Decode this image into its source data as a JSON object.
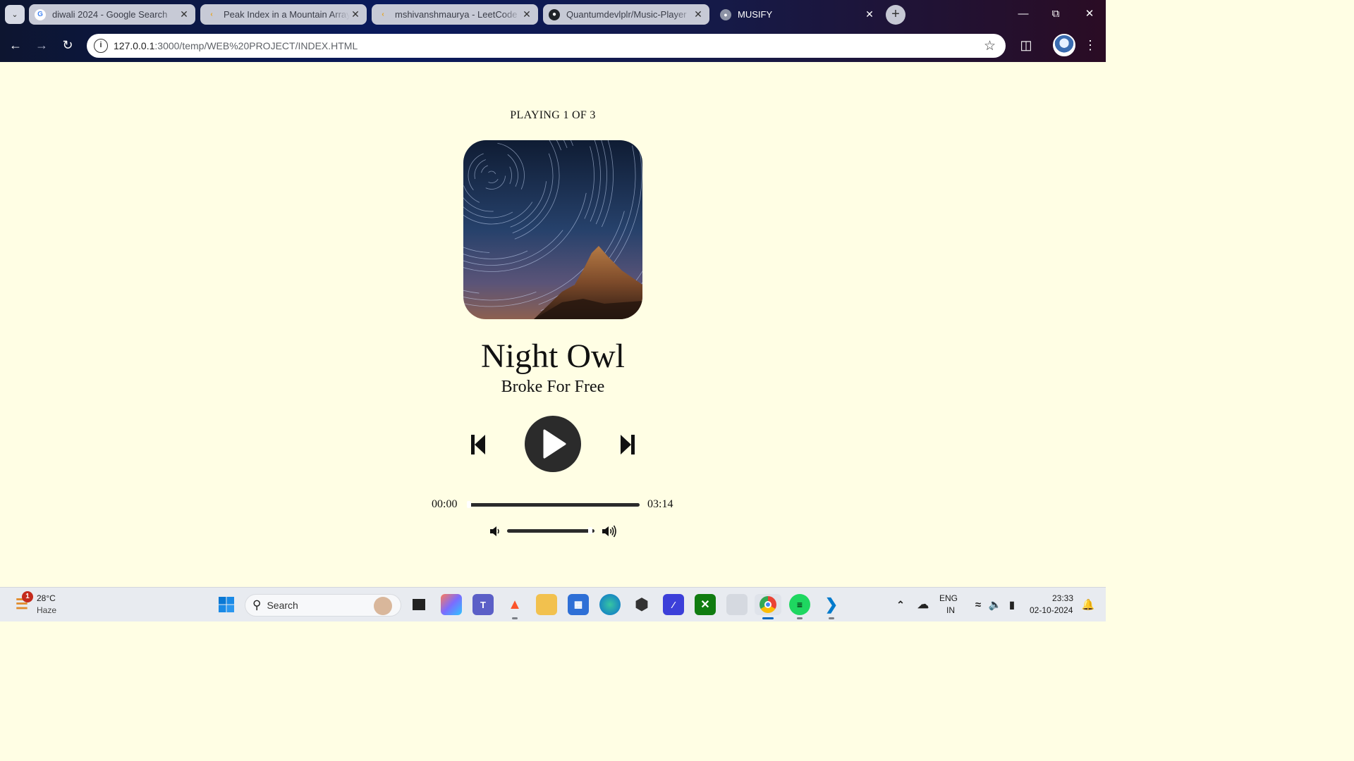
{
  "browser": {
    "tabs": [
      {
        "title": "diwali 2024 - Google Search",
        "icon": "google-icon",
        "active": false
      },
      {
        "title": "Peak Index in a Mountain Array",
        "icon": "leetcode-icon",
        "active": false
      },
      {
        "title": "mshivanshmaurya - LeetCode P",
        "icon": "leetcode-icon",
        "active": false
      },
      {
        "title": "Quantumdevlplr/Music-Player",
        "icon": "github-icon",
        "active": false
      },
      {
        "title": "MUSIFY",
        "icon": "globe-icon",
        "active": true
      }
    ],
    "url_host": "127.0.0.1",
    "url_path": ":3000/temp/WEB%20PROJECT/INDEX.HTML"
  },
  "player": {
    "playing_status": "PLAYING 1 OF 3",
    "song_title": "Night Owl",
    "artist": "Broke For Free",
    "current_time": "00:00",
    "duration": "03:14",
    "progress_fraction": 0.0,
    "volume_fraction": 0.95,
    "is_playing": false
  },
  "taskbar": {
    "weather_temp": "28°C",
    "weather_desc": "Haze",
    "weather_badge": "1",
    "search_placeholder": "Search",
    "language_top": "ENG",
    "language_bottom": "IN",
    "clock_time": "23:33",
    "clock_date": "02-10-2024"
  },
  "colors": {
    "page_background": "#fffee4",
    "control_dark": "#2b2b2b",
    "text": "#111111"
  }
}
